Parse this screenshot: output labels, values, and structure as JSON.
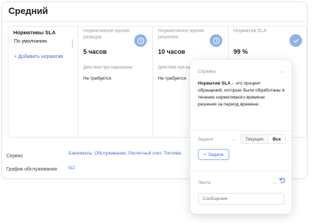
{
  "card": {
    "title": "Средний"
  },
  "sla": {
    "heading": "Нормативы SLA",
    "default_item": "По умолчанию",
    "add_link": "+ Добавить норматив"
  },
  "metrics": [
    {
      "label": "Нормативное время реакции",
      "value": "5 часов",
      "icon": "clock-icon",
      "action_label": "Действия при нарушении",
      "action_value": "Не требуется"
    },
    {
      "label": "Нормативное время решения",
      "value": "10 часов",
      "icon": "clock-icon",
      "action_label": "Действия при на",
      "action_value": "Не требуется"
    },
    {
      "label": "Норматив SLA",
      "value": "99 %",
      "icon": "check-icon"
    }
  ],
  "rows": {
    "service_label": "Сервис",
    "services": [
      "Банкоматы",
      "Обслуживание",
      "Расчетный счет",
      "Топлива"
    ],
    "schedule_label": "График обслуживания",
    "schedule_value": "5/2"
  },
  "panel": {
    "help_title": "Справка",
    "help_bold": "Норматив SLA",
    "help_text": " – это процент обращений, которые были обработаны в течение нормативного времени решения за период времени.",
    "tasks_title": "Задачи",
    "tabs": [
      "Текущие",
      "Все"
    ],
    "add_task": "Задача",
    "feed_title": "Лента",
    "message_placeholder": "Сообщение"
  },
  "colors": {
    "accent": "#3a6fd8",
    "icon_bg": "#8fb2e6",
    "border": "#e6e8ee"
  }
}
